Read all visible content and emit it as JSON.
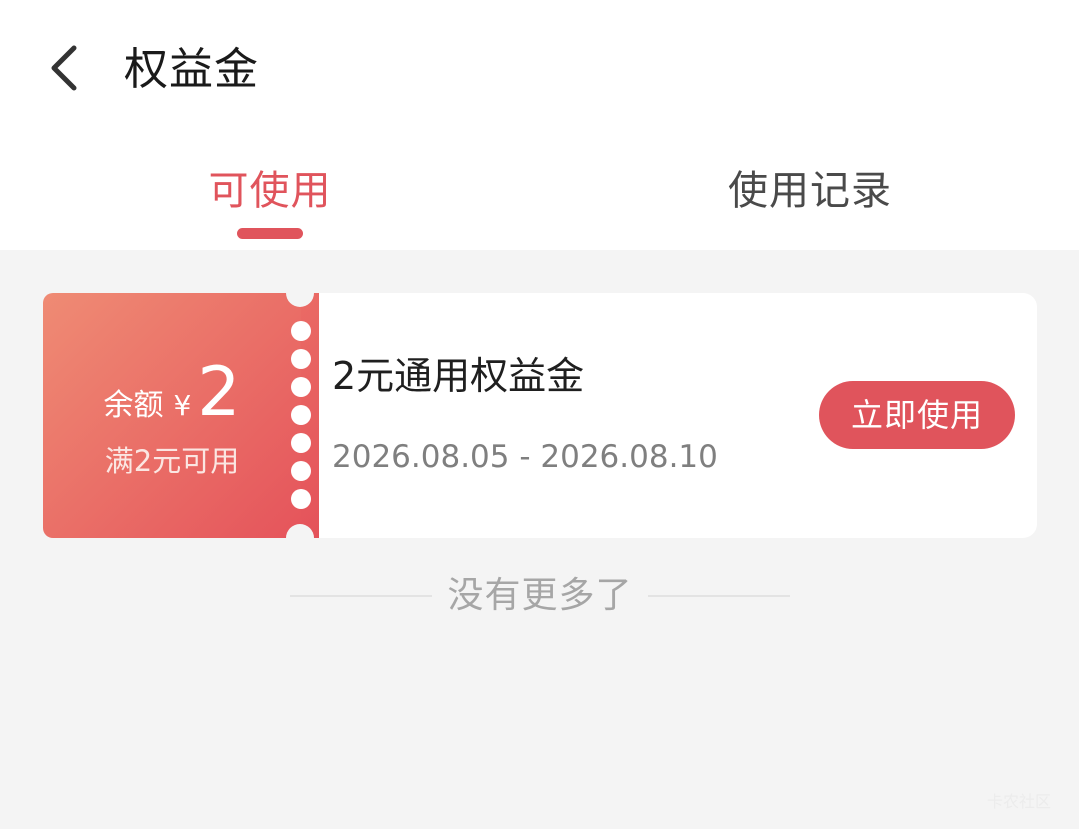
{
  "header": {
    "title": "权益金",
    "back_icon": "chevron-left-icon"
  },
  "tabs": [
    {
      "label": "可使用",
      "active": true
    },
    {
      "label": "使用记录",
      "active": false
    }
  ],
  "colors": {
    "accent": "#e0545c",
    "coupon_gradient_start": "#ef8b74",
    "coupon_gradient_end": "#e5545b",
    "background": "#f4f4f4"
  },
  "coupon": {
    "amount_label": "余额",
    "currency": "¥",
    "amount": "2",
    "condition": "满2元可用",
    "title": "2元通用权益金",
    "validity": "2026.08.05 - 2026.08.10",
    "action_label": "立即使用"
  },
  "footer": {
    "end_text": "没有更多了",
    "watermark": "卡农社区"
  }
}
